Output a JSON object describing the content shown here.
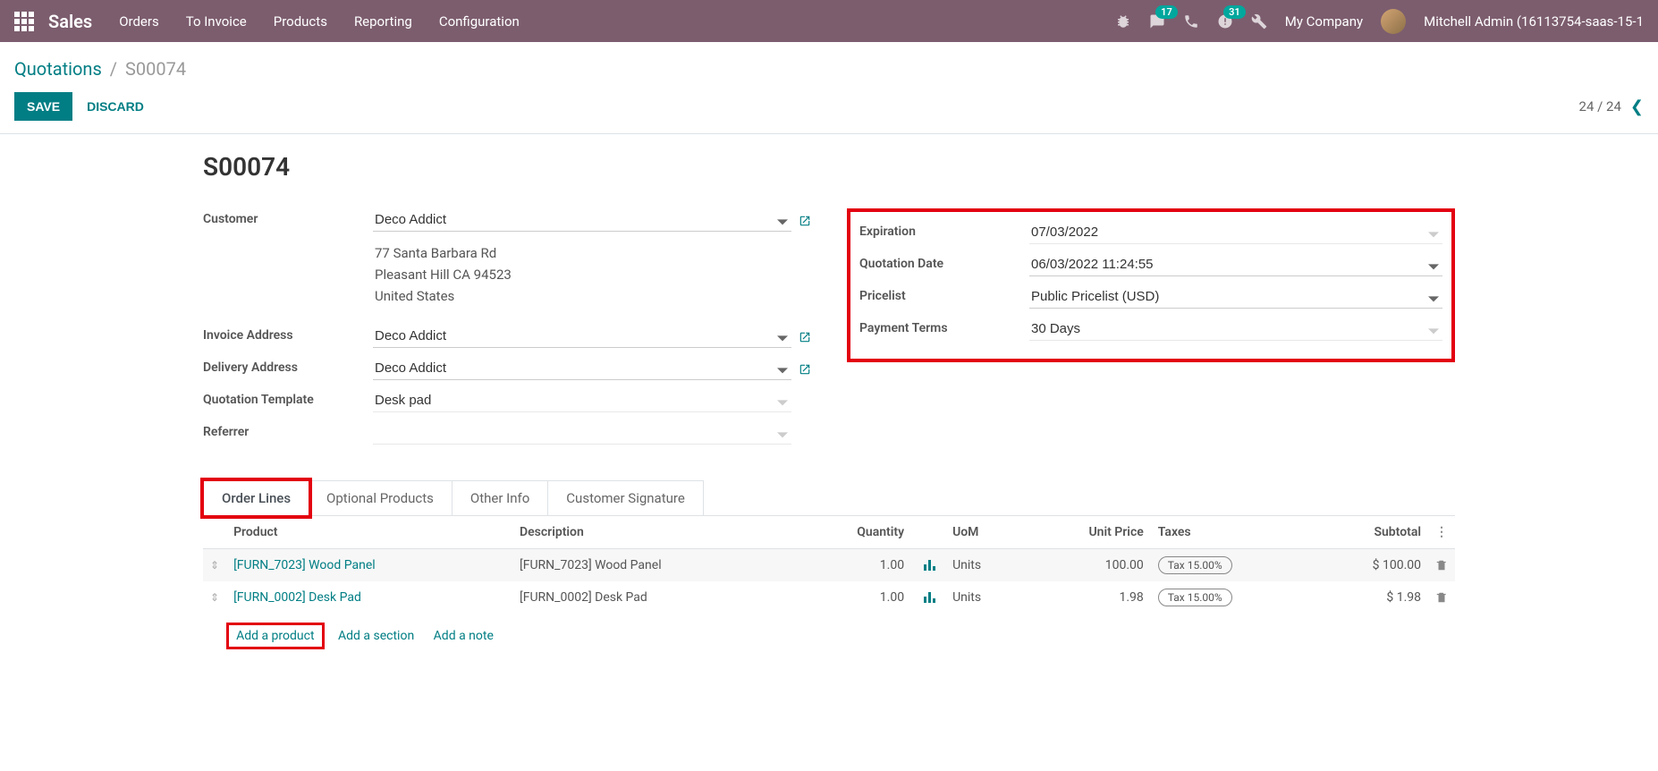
{
  "topnav": {
    "brand": "Sales",
    "items": [
      "Orders",
      "To Invoice",
      "Products",
      "Reporting",
      "Configuration"
    ],
    "messages_badge": "17",
    "activities_badge": "31",
    "company": "My Company",
    "user": "Mitchell Admin (16113754-saas-15-1"
  },
  "breadcrumb": {
    "parent": "Quotations",
    "current": "S00074"
  },
  "actions": {
    "save": "SAVE",
    "discard": "DISCARD",
    "pager": "24 / 24"
  },
  "record": {
    "title": "S00074",
    "left": {
      "customer_label": "Customer",
      "customer": "Deco Addict",
      "address_line1": "77 Santa Barbara Rd",
      "address_line2": "Pleasant Hill CA 94523",
      "address_line3": "United States",
      "invoice_label": "Invoice Address",
      "invoice": "Deco Addict",
      "delivery_label": "Delivery Address",
      "delivery": "Deco Addict",
      "template_label": "Quotation Template",
      "template": "Desk pad",
      "referrer_label": "Referrer",
      "referrer": ""
    },
    "right": {
      "expiration_label": "Expiration",
      "expiration": "07/03/2022",
      "qdate_label": "Quotation Date",
      "qdate": "06/03/2022 11:24:55",
      "pricelist_label": "Pricelist",
      "pricelist": "Public Pricelist (USD)",
      "terms_label": "Payment Terms",
      "terms": "30 Days"
    }
  },
  "tabs": [
    "Order Lines",
    "Optional Products",
    "Other Info",
    "Customer Signature"
  ],
  "table": {
    "headers": {
      "product": "Product",
      "description": "Description",
      "quantity": "Quantity",
      "uom": "UoM",
      "unit_price": "Unit Price",
      "taxes": "Taxes",
      "subtotal": "Subtotal"
    },
    "rows": [
      {
        "product": "[FURN_7023] Wood Panel",
        "description": "[FURN_7023] Wood Panel",
        "qty": "1.00",
        "uom": "Units",
        "price": "100.00",
        "tax": "Tax 15.00%",
        "subtotal": "$ 100.00"
      },
      {
        "product": "[FURN_0002] Desk Pad",
        "description": "[FURN_0002] Desk Pad",
        "qty": "1.00",
        "uom": "Units",
        "price": "1.98",
        "tax": "Tax 15.00%",
        "subtotal": "$ 1.98"
      }
    ],
    "add": {
      "product": "Add a product",
      "section": "Add a section",
      "note": "Add a note"
    }
  }
}
